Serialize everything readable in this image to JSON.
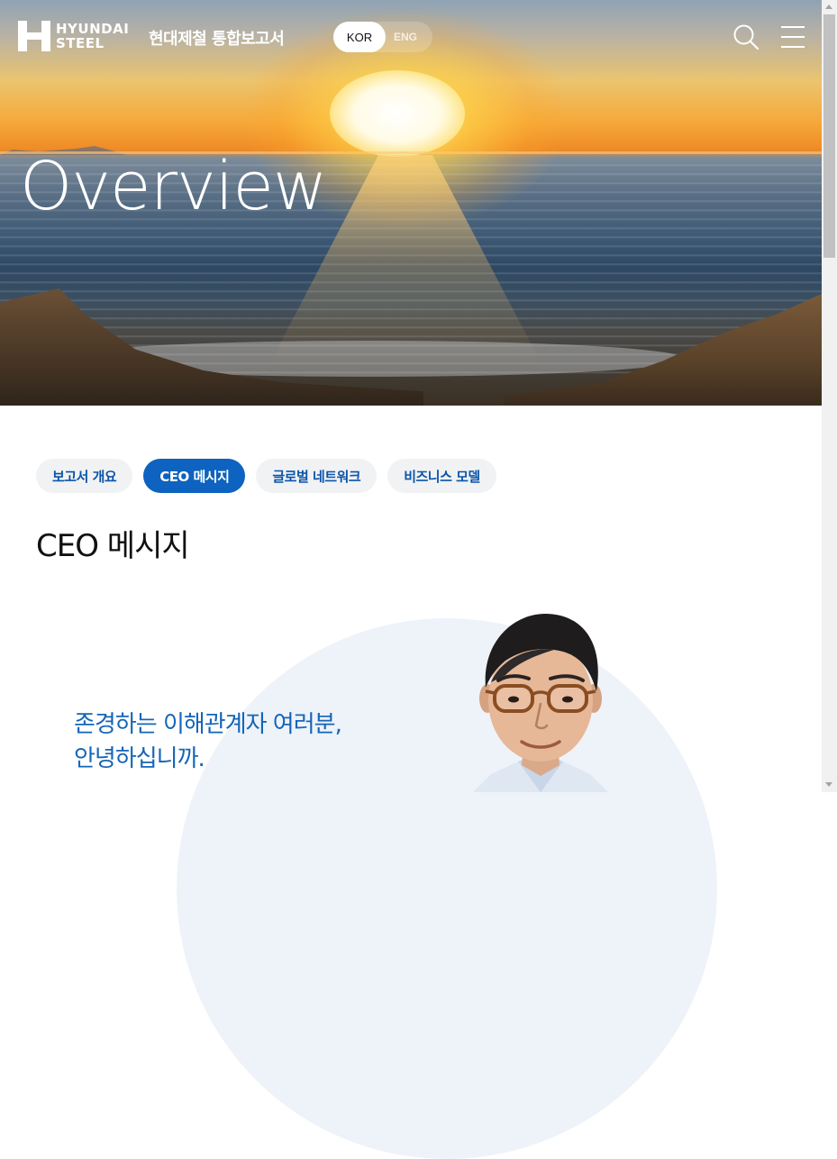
{
  "header": {
    "logo_line1": "HYUNDAI",
    "logo_line2": "STEEL",
    "report_title": "현대제철 통합보고서",
    "lang_active": "KOR",
    "lang_inactive": "ENG",
    "icons": {
      "search": "search-icon",
      "menu": "hamburger-menu-icon"
    }
  },
  "hero": {
    "title": "Overview"
  },
  "tabs": [
    {
      "label": "보고서 개요",
      "active": false
    },
    {
      "label": "CEO 메시지",
      "active": true
    },
    {
      "label": "글로벌 네트워크",
      "active": false
    },
    {
      "label": "비즈니스 모델",
      "active": false
    }
  ],
  "section": {
    "title": "CEO 메시지",
    "greeting_line1": "존경하는 이해관계자 여러분,",
    "greeting_line2": "안녕하십니까."
  },
  "colors": {
    "brand_blue": "#0d63bf",
    "greeting_blue": "#1565b8",
    "tab_bg": "#f1f2f4"
  }
}
